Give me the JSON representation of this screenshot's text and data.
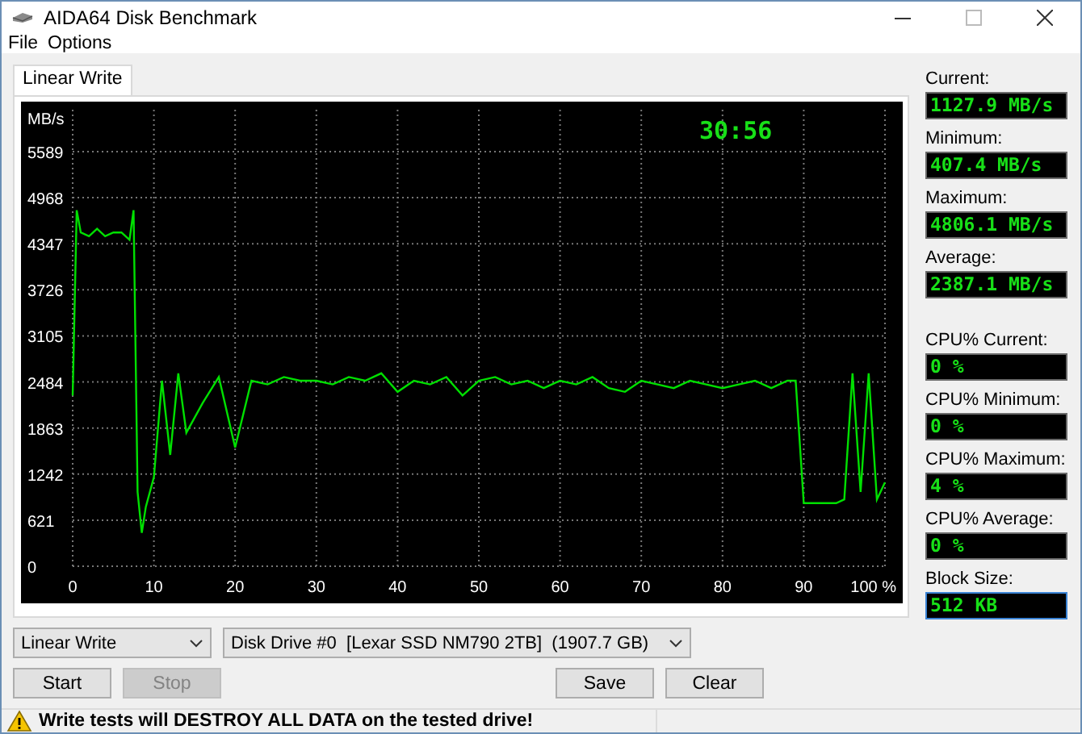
{
  "window": {
    "title": "AIDA64 Disk Benchmark"
  },
  "menu": [
    {
      "label": "File"
    },
    {
      "label": "Options"
    }
  ],
  "tabs": [
    {
      "label": "Linear Write",
      "selected": true
    }
  ],
  "chart": {
    "elapsed": "30:56",
    "chart_data": {
      "type": "line",
      "ylabel": "MB/s",
      "xlim": [
        0,
        100
      ],
      "ylim": [
        0,
        5589
      ],
      "yticks": [
        0,
        621,
        1242,
        1863,
        2484,
        3105,
        3726,
        4347,
        4968,
        5589
      ],
      "xticks": [
        0,
        10,
        20,
        30,
        40,
        50,
        60,
        70,
        80,
        90,
        {
          "value": 100,
          "label": "100 %"
        }
      ],
      "x": [
        0,
        0.5,
        1,
        2,
        3,
        4,
        5,
        6,
        7,
        7.5,
        8,
        8.5,
        9,
        10,
        11,
        12,
        13,
        14,
        16,
        18,
        20,
        22,
        24,
        26,
        28,
        30,
        32,
        34,
        36,
        38,
        40,
        42,
        44,
        46,
        48,
        50,
        52,
        54,
        56,
        58,
        60,
        62,
        64,
        66,
        68,
        70,
        72,
        74,
        76,
        78,
        80,
        82,
        84,
        86,
        88,
        89,
        90,
        92,
        94,
        95,
        96,
        97,
        98,
        99,
        100
      ],
      "grid": true,
      "series": [
        {
          "color": "#00e000",
          "values": [
            2300,
            4800,
            4500,
            4450,
            4550,
            4450,
            4500,
            4500,
            4400,
            4800,
            1000,
            450,
            800,
            1200,
            2500,
            1500,
            2600,
            1800,
            2200,
            2550,
            1600,
            2500,
            2450,
            2550,
            2500,
            2500,
            2450,
            2550,
            2500,
            2600,
            2350,
            2500,
            2450,
            2550,
            2300,
            2500,
            2550,
            2450,
            2500,
            2400,
            2500,
            2450,
            2550,
            2400,
            2350,
            2500,
            2450,
            2400,
            2500,
            2450,
            2400,
            2450,
            2500,
            2400,
            2500,
            2500,
            850,
            850,
            850,
            900,
            2600,
            1000,
            2600,
            900,
            1130
          ]
        }
      ]
    }
  },
  "throughput": [
    {
      "label": "Current:",
      "value": "1127.9 MB/s"
    },
    {
      "label": "Minimum:",
      "value": "407.4 MB/s"
    },
    {
      "label": "Maximum:",
      "value": "4806.1 MB/s"
    },
    {
      "label": "Average:",
      "value": "2387.1 MB/s"
    }
  ],
  "cpu": [
    {
      "label": "CPU% Current:",
      "value": "0 %"
    },
    {
      "label": "CPU% Minimum:",
      "value": "0 %"
    },
    {
      "label": "CPU% Maximum:",
      "value": "4 %"
    },
    {
      "label": "CPU% Average:",
      "value": "0 %"
    }
  ],
  "block_size": {
    "label": "Block Size:",
    "value": "512 KB",
    "focused": true
  },
  "test_select": {
    "value": "Linear Write"
  },
  "drive_select": {
    "value": "Disk Drive #0  [Lexar SSD NM790 2TB]  (1907.7 GB)"
  },
  "buttons_left": [
    {
      "label": "Start",
      "disabled": false
    },
    {
      "label": "Stop",
      "disabled": true
    }
  ],
  "buttons_right": [
    {
      "label": "Save",
      "disabled": false
    },
    {
      "label": "Clear",
      "disabled": false
    }
  ],
  "status_bar": {
    "warning": "Write tests will DESTROY ALL DATA on the tested drive!"
  }
}
